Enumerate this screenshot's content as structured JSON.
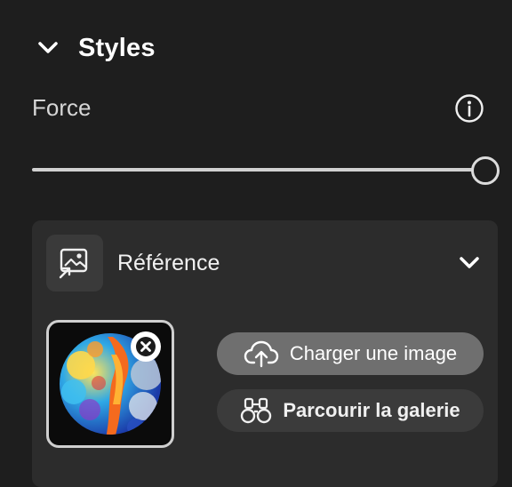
{
  "section": {
    "title": "Styles",
    "expanded": true
  },
  "force": {
    "label": "Force",
    "value_fraction": 1.0
  },
  "reference": {
    "title": "Référence",
    "expanded": true,
    "upload_label": "Charger une image",
    "gallery_label": "Parcourir la galerie"
  },
  "icons": {
    "section_toggle": "chevron-down-icon",
    "info": "info-icon",
    "reference": "image-reference-icon",
    "reference_toggle": "chevron-down-icon",
    "remove": "close-circle-icon",
    "upload": "cloud-upload-icon",
    "gallery": "binoculars-icon"
  },
  "colors": {
    "background": "#1e1e1e",
    "panel": "#2c2c2c",
    "upload_button": "#6f6f6f",
    "gallery_button": "#3b3b3b"
  }
}
